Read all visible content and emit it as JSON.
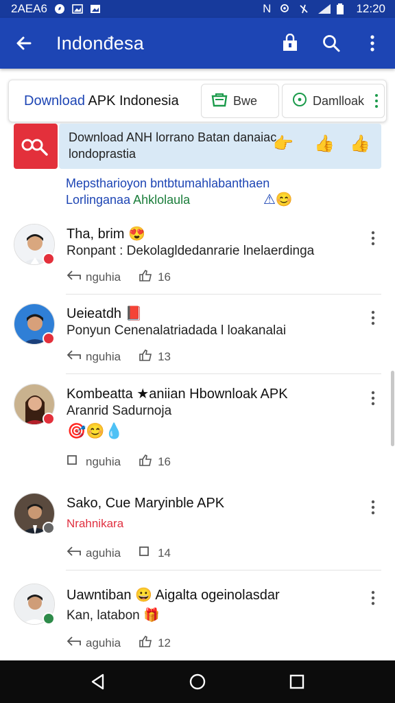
{
  "status_bar": {
    "left_text": "2AEA6",
    "time": "12:20",
    "network": "N"
  },
  "app_bar": {
    "title": "Indonđesa"
  },
  "search_card": {
    "query_blue": "Download",
    "query_rest": " APK Indonesia",
    "chip1": "Bwe",
    "chip2": "Damlloak"
  },
  "result": {
    "line1": "Download ANH lorrano Batan danaiac",
    "line2": "londoprastia"
  },
  "description": {
    "line1": "Mepstharioyon bntbtumahlabanthaen",
    "line2_blue": "Lorlinganaa ",
    "line2_green": "Ahklolaula"
  },
  "comments": [
    {
      "name": "Tha, brim 😍",
      "text": "Ronpant : Dekolaglde­danrarie lnelaerdinga",
      "reply": "nguhia",
      "likes": "16",
      "badge_color": "#e3303b"
    },
    {
      "name": "Ueieatdh",
      "text": "Ponyun Cenenalatriadada l loakanalai",
      "reply": "nguhia",
      "likes": "13",
      "badge_color": "#e3303b"
    },
    {
      "name": "Kombeatta ★aniian Hbownloak APK",
      "text": "Aranrid Sadurnoja",
      "reply": "nguhia",
      "likes": "16",
      "badge_color": "#e3303b"
    },
    {
      "name": "Sako, Cue Maryinble APK",
      "text": "Nrahnikara",
      "reply": "aguhia",
      "likes": "14",
      "badge_color": "#666666"
    },
    {
      "name": "Uawntiban 😀 Aigalta ogeinolasdar",
      "text": "Kan, latabon 🎁",
      "reply": "aguhia",
      "likes": "12",
      "badge_color": "#2e8b4a"
    }
  ],
  "colors": {
    "primary": "#1d45b4",
    "status": "#173a9c",
    "accent_red": "#e3303b",
    "green": "#1a7d3a"
  }
}
